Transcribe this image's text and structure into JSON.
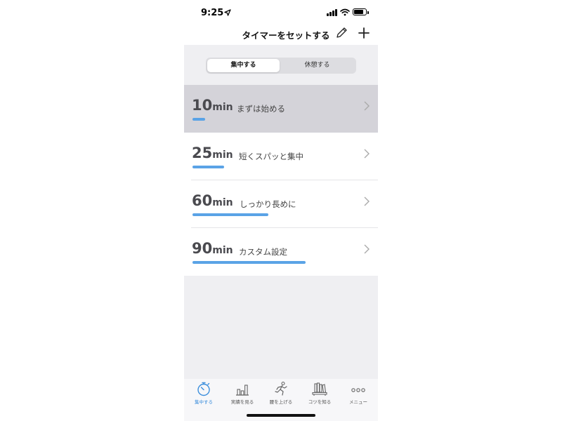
{
  "status_bar": {
    "time": "9:25",
    "location_icon": "location-arrow-icon",
    "signal_icon": "cellular-signal-icon",
    "wifi_icon": "wifi-icon",
    "battery_icon": "battery-icon",
    "battery_level": 0.8
  },
  "nav": {
    "title": "タイマーをセットする",
    "edit_icon": "pencil-icon",
    "add_icon": "plus-icon"
  },
  "segment": {
    "options": [
      "集中する",
      "休憩する"
    ],
    "selected": "集中する"
  },
  "timers": [
    {
      "minutes": "10",
      "unit": "min",
      "label": "まずは始める",
      "fraction": 0.11,
      "selected": true
    },
    {
      "minutes": "25",
      "unit": "min",
      "label": "短くスパッと集中",
      "fraction": 0.28,
      "selected": false
    },
    {
      "minutes": "60",
      "unit": "min",
      "label": "しっかり長めに",
      "fraction": 0.67,
      "selected": false
    },
    {
      "minutes": "90",
      "unit": "min",
      "label": "カスタム設定",
      "fraction": 1.0,
      "selected": false
    }
  ],
  "tabbar": {
    "tabs": [
      {
        "label": "集中する",
        "icon": "stopwatch-icon",
        "active": true
      },
      {
        "label": "実績を見る",
        "icon": "bar-chart-icon",
        "active": false
      },
      {
        "label": "腰を上げる",
        "icon": "running-person-icon",
        "active": false
      },
      {
        "label": "コツを知る",
        "icon": "bookshelf-icon",
        "active": false
      },
      {
        "label": "メニュー",
        "icon": "more-dots-icon",
        "active": false
      }
    ]
  },
  "colors": {
    "accent": "#5aa3e6",
    "tab_active": "#3d8fdc",
    "selected_row": "#d4d3d9",
    "background": "#efeff2"
  }
}
